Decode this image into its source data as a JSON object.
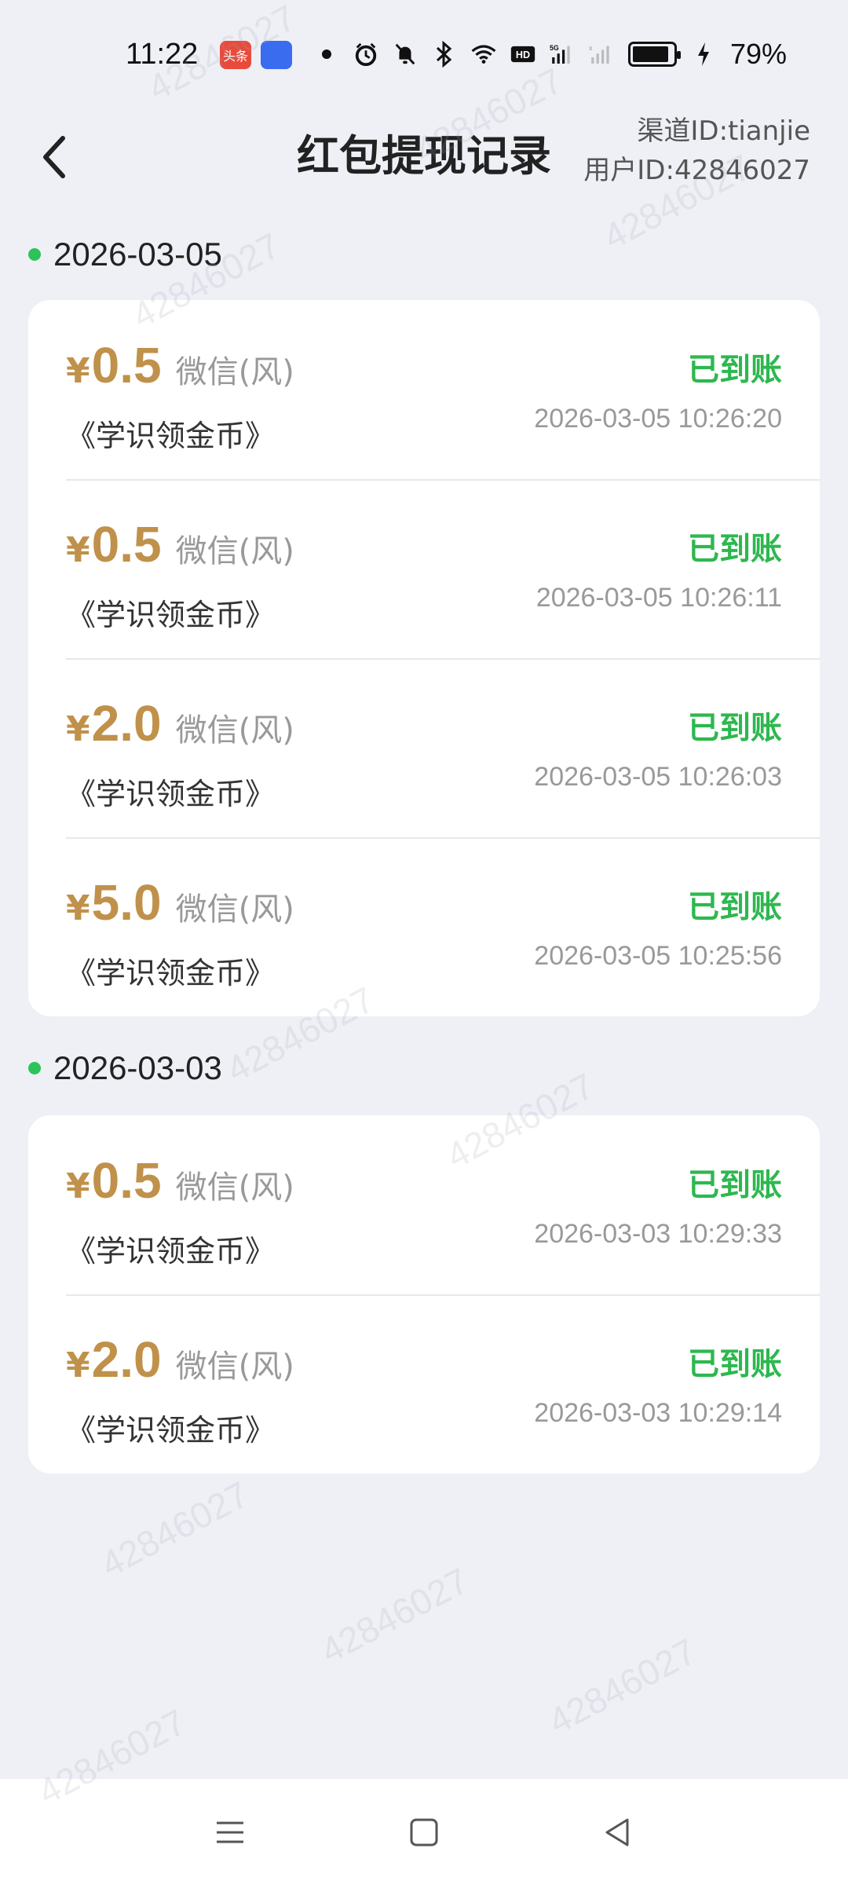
{
  "status_bar": {
    "time": "11:22",
    "battery_percent": "79%",
    "battery_level": 0.79,
    "icons": [
      "toutiao-app-icon",
      "baidu-app-icon",
      "dot-icon",
      "alarm-icon",
      "mute-icon",
      "bluetooth-icon",
      "wifi-icon",
      "hd-icon",
      "signal-5g-icon",
      "signal-icon",
      "battery-icon",
      "charging-icon"
    ],
    "notif_app_label": "头条"
  },
  "header": {
    "title": "红包提现记录",
    "channel_id": "渠道ID:tianjie",
    "user_id": "用户ID:42846027"
  },
  "groups": [
    {
      "date": "2026-03-05",
      "records": [
        {
          "yen": "¥",
          "amount": "0.5",
          "channel": "微信(风)",
          "task": "《学识领金币》",
          "status": "已到账",
          "time": "2026-03-05 10:26:20"
        },
        {
          "yen": "¥",
          "amount": "0.5",
          "channel": "微信(风)",
          "task": "《学识领金币》",
          "status": "已到账",
          "time": "2026-03-05 10:26:11"
        },
        {
          "yen": "¥",
          "amount": "2.0",
          "channel": "微信(风)",
          "task": "《学识领金币》",
          "status": "已到账",
          "time": "2026-03-05 10:26:03"
        },
        {
          "yen": "¥",
          "amount": "5.0",
          "channel": "微信(风)",
          "task": "《学识领金币》",
          "status": "已到账",
          "time": "2026-03-05 10:25:56"
        }
      ]
    },
    {
      "date": "2026-03-03",
      "records": [
        {
          "yen": "¥",
          "amount": "0.5",
          "channel": "微信(风)",
          "task": "《学识领金币》",
          "status": "已到账",
          "time": "2026-03-03 10:29:33"
        },
        {
          "yen": "¥",
          "amount": "2.0",
          "channel": "微信(风)",
          "task": "《学识领金币》",
          "status": "已到账",
          "time": "2026-03-03 10:29:14"
        }
      ]
    }
  ],
  "watermark": "42846027",
  "colors": {
    "background": "#eef0f6",
    "amount": "#c0914a",
    "status_green": "#2db84f",
    "date_dot": "#2ec35a"
  },
  "nav_bar": {
    "icons": [
      "menu-icon",
      "home-square-icon",
      "back-triangle-icon"
    ]
  }
}
